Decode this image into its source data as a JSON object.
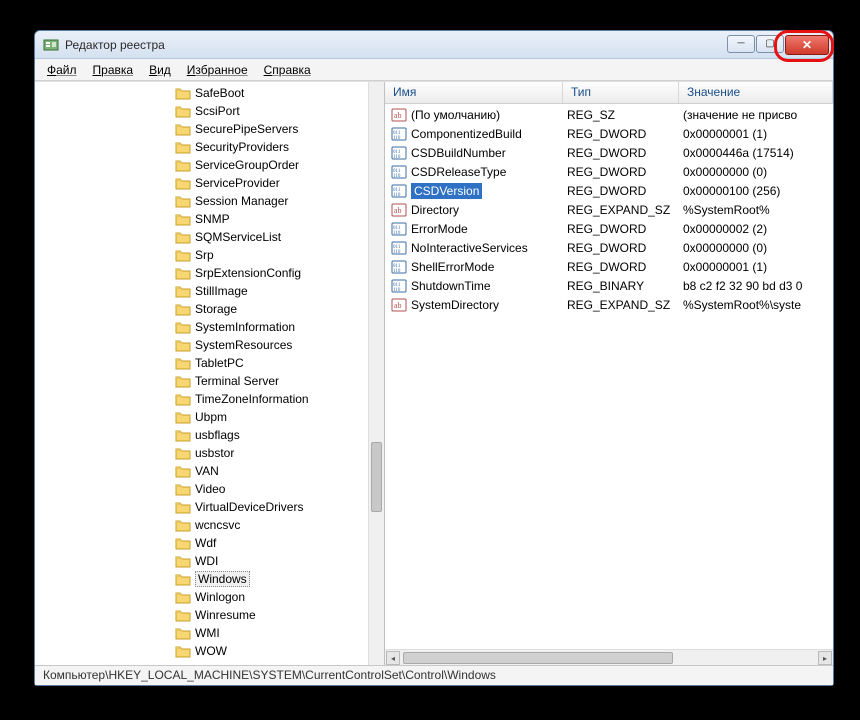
{
  "window": {
    "title": "Редактор реестра"
  },
  "menu": {
    "file": "Файл",
    "edit": "Правка",
    "view": "Вид",
    "favorites": "Избранное",
    "help": "Справка"
  },
  "tree": {
    "selected": "Windows",
    "items": [
      {
        "label": "SafeBoot"
      },
      {
        "label": "ScsiPort"
      },
      {
        "label": "SecurePipeServers"
      },
      {
        "label": "SecurityProviders"
      },
      {
        "label": "ServiceGroupOrder"
      },
      {
        "label": "ServiceProvider"
      },
      {
        "label": "Session Manager"
      },
      {
        "label": "SNMP"
      },
      {
        "label": "SQMServiceList"
      },
      {
        "label": "Srp"
      },
      {
        "label": "SrpExtensionConfig"
      },
      {
        "label": "StillImage"
      },
      {
        "label": "Storage"
      },
      {
        "label": "SystemInformation"
      },
      {
        "label": "SystemResources"
      },
      {
        "label": "TabletPC"
      },
      {
        "label": "Terminal Server"
      },
      {
        "label": "TimeZoneInformation"
      },
      {
        "label": "Ubpm"
      },
      {
        "label": "usbflags"
      },
      {
        "label": "usbstor"
      },
      {
        "label": "VAN"
      },
      {
        "label": "Video"
      },
      {
        "label": "VirtualDeviceDrivers"
      },
      {
        "label": "wcncsvc"
      },
      {
        "label": "Wdf"
      },
      {
        "label": "WDI"
      },
      {
        "label": "Windows"
      },
      {
        "label": "Winlogon"
      },
      {
        "label": "Winresume"
      },
      {
        "label": "WMI"
      },
      {
        "label": "WOW"
      }
    ]
  },
  "columns": {
    "name": "Имя",
    "type": "Тип",
    "value": "Значение"
  },
  "values": [
    {
      "icon": "str",
      "name": "(По умолчанию)",
      "type": "REG_SZ",
      "value": "(значение не присво"
    },
    {
      "icon": "bin",
      "name": "ComponentizedBuild",
      "type": "REG_DWORD",
      "value": "0x00000001 (1)"
    },
    {
      "icon": "bin",
      "name": "CSDBuildNumber",
      "type": "REG_DWORD",
      "value": "0x0000446a (17514)"
    },
    {
      "icon": "bin",
      "name": "CSDReleaseType",
      "type": "REG_DWORD",
      "value": "0x00000000 (0)"
    },
    {
      "icon": "bin",
      "name": "CSDVersion",
      "type": "REG_DWORD",
      "value": "0x00000100 (256)",
      "selected": true
    },
    {
      "icon": "str",
      "name": "Directory",
      "type": "REG_EXPAND_SZ",
      "value": "%SystemRoot%"
    },
    {
      "icon": "bin",
      "name": "ErrorMode",
      "type": "REG_DWORD",
      "value": "0x00000002 (2)"
    },
    {
      "icon": "bin",
      "name": "NoInteractiveServices",
      "type": "REG_DWORD",
      "value": "0x00000000 (0)"
    },
    {
      "icon": "bin",
      "name": "ShellErrorMode",
      "type": "REG_DWORD",
      "value": "0x00000001 (1)"
    },
    {
      "icon": "bin",
      "name": "ShutdownTime",
      "type": "REG_BINARY",
      "value": "b8 c2 f2 32 90 bd d3 0"
    },
    {
      "icon": "str",
      "name": "SystemDirectory",
      "type": "REG_EXPAND_SZ",
      "value": "%SystemRoot%\\syste"
    }
  ],
  "statusbar": "Компьютер\\HKEY_LOCAL_MACHINE\\SYSTEM\\CurrentControlSet\\Control\\Windows"
}
